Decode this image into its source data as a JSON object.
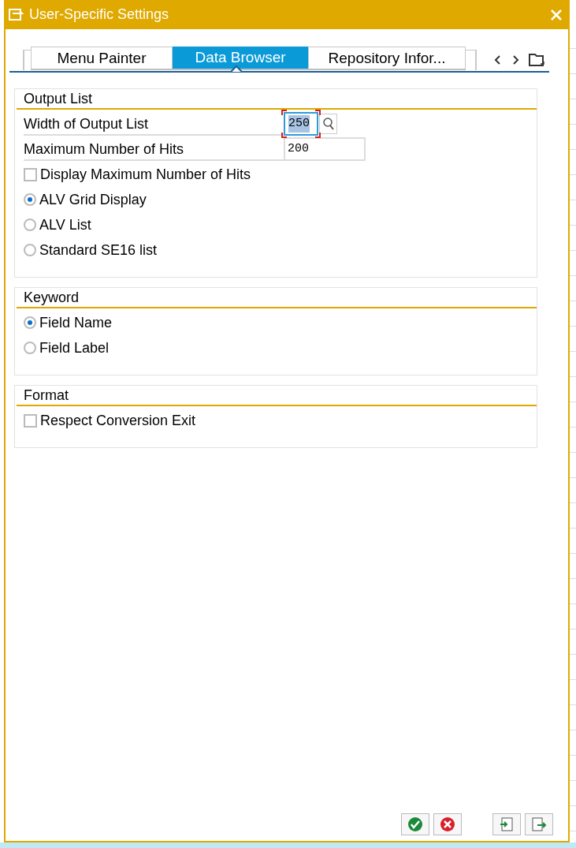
{
  "window": {
    "title": "User-Specific Settings"
  },
  "tabs": [
    {
      "label": "Menu Painter",
      "selected": false
    },
    {
      "label": "Data Browser",
      "selected": true
    },
    {
      "label": "Repository Infor...",
      "selected": false
    }
  ],
  "groups": [
    {
      "title": "Output List",
      "items": [
        {
          "kind": "field",
          "label": "Width of Output List",
          "value": "250",
          "focused": true,
          "help": true
        },
        {
          "kind": "field",
          "label": "Maximum Number of Hits",
          "value": "200",
          "focused": false,
          "help": false
        },
        {
          "kind": "checkbox",
          "label": "Display Maximum Number of Hits",
          "checked": false
        },
        {
          "kind": "radio",
          "label": "ALV Grid Display",
          "selected": true
        },
        {
          "kind": "radio",
          "label": "ALV List",
          "selected": false
        },
        {
          "kind": "radio",
          "label": "Standard SE16 list",
          "selected": false
        }
      ]
    },
    {
      "title": "Keyword",
      "items": [
        {
          "kind": "radio",
          "label": "Field Name",
          "selected": true
        },
        {
          "kind": "radio",
          "label": "Field Label",
          "selected": false
        }
      ]
    },
    {
      "title": "Format",
      "items": [
        {
          "kind": "checkbox",
          "label": "Respect Conversion Exit",
          "checked": false
        }
      ]
    }
  ],
  "buttons": [
    {
      "kind": "confirm"
    },
    {
      "kind": "cancel"
    },
    {
      "kind": "import"
    },
    {
      "kind": "export"
    }
  ]
}
